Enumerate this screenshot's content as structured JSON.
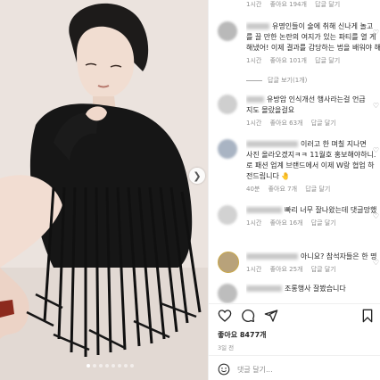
{
  "comments": [
    {
      "time": "1시간",
      "likes": "좋아요 194개",
      "reply": "답글 달기"
    },
    {
      "text_lines": [
        "유명인들이 술에 취해 신나게 놀고",
        "를 끌 만한 논란의 여지가 있는 파티를 열 게",
        "해냈어! 이제 결과를 감당하는 법을 배워야 해"
      ],
      "time": "1시간",
      "likes": "좋아요 101개",
      "reply": "답글 달기"
    },
    {
      "replies_label": "답글 보기(1개)"
    },
    {
      "text_lines": [
        "유방암 인식개선 행사라는걸 언급",
        "지도 몰랐을걸요"
      ],
      "time": "1시간",
      "likes": "좋아요 63개",
      "reply": "답글 달기"
    },
    {
      "text_lines": [
        "이러고 한 며칠 지나면",
        "사진 올라오겠지ㅋㅋ 11월호 홍보해야하니.",
        "로 패션 업계 브랜드에서 이제 W랑 협업 하",
        "전드립니다 🤚"
      ],
      "time": "40분",
      "likes": "좋아요 7개",
      "reply": "답글 달기"
    },
    {
      "text_lines": [
        "빠리 너무 잘나왔는데 댓글망했"
      ],
      "time": "1시간",
      "likes": "좋아요 16개",
      "reply": "답글 달기"
    },
    {
      "text_lines": [
        "아니요? 참석자들은 한 명"
      ],
      "time": "1시간",
      "likes": "좋아요 25개",
      "reply": "답글 달기"
    },
    {
      "text_lines": [
        "조롱행사 잘봤습니다"
      ]
    }
  ],
  "actions": {
    "like_icon": "heart-icon",
    "comment_icon": "comment-icon",
    "share_icon": "share-icon",
    "save_icon": "bookmark-icon"
  },
  "post": {
    "likes": "좋아요 8477개",
    "date": "3일 전"
  },
  "add_comment": {
    "placeholder": "댓글 달기..."
  },
  "carousel": {
    "next_icon": "chevron-right-icon",
    "slide_count": 8,
    "active_slide": 1
  }
}
